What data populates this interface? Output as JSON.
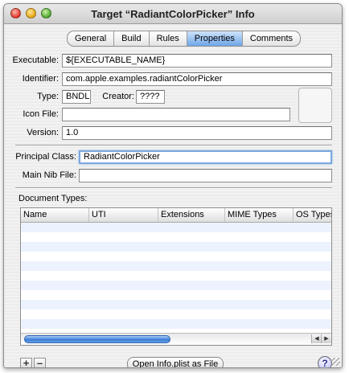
{
  "window": {
    "title": "Target “RadiantColorPicker” Info"
  },
  "tabs": [
    {
      "label": "General"
    },
    {
      "label": "Build"
    },
    {
      "label": "Rules"
    },
    {
      "label": "Properties",
      "selected": true
    },
    {
      "label": "Comments"
    }
  ],
  "properties": {
    "executable_label": "Executable:",
    "executable_value": "${EXECUTABLE_NAME}",
    "identifier_label": "Identifier:",
    "identifier_value": "com.apple.examples.radiantColorPicker",
    "type_label": "Type:",
    "type_value": "BNDL",
    "creator_label": "Creator:",
    "creator_value": "????",
    "icon_file_label": "Icon File:",
    "icon_file_value": "",
    "version_label": "Version:",
    "version_value": "1.0",
    "principal_class_label": "Principal Class:",
    "principal_class_value": "RadiantColorPicker",
    "main_nib_label": "Main Nib File:",
    "main_nib_value": ""
  },
  "document_types": {
    "label": "Document Types:",
    "columns": [
      "Name",
      "UTI",
      "Extensions",
      "MIME Types",
      "OS Types"
    ],
    "empty_rows": 11
  },
  "footer": {
    "add_label": "+",
    "remove_label": "–",
    "open_button_label": "Open Info.plist as File",
    "help_label": "?"
  },
  "colors": {
    "accent": "#6ea6e8",
    "row_stripe": "#edf3fe",
    "scroll_thumb": "#3a7bd5"
  },
  "icons": [
    "close-icon",
    "minimize-icon",
    "zoom-icon",
    "help-icon",
    "scroll-left-icon",
    "scroll-right-icon",
    "resize-grip-icon"
  ]
}
